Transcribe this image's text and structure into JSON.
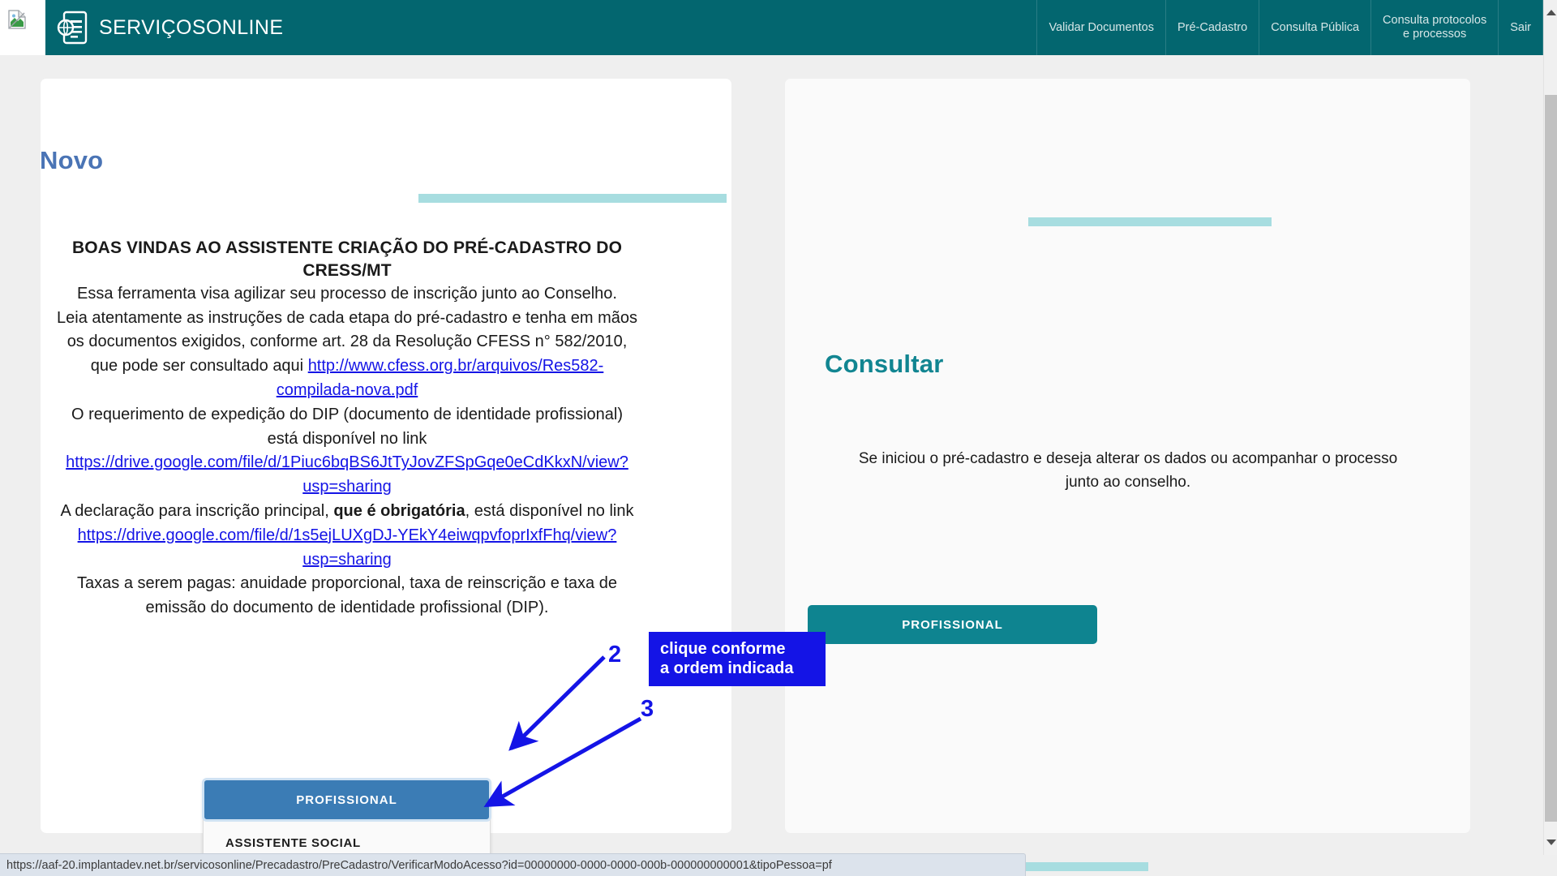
{
  "header": {
    "brand": "SERVIÇOSONLINE",
    "logo_icon": "document-globe-icon",
    "brand_bg": "#03666f",
    "nav": [
      {
        "label": "Validar Documentos"
      },
      {
        "label": "Pré-Cadastro"
      },
      {
        "label": "Consulta Pública"
      },
      {
        "label": "Consulta protocolos\ne processos"
      },
      {
        "label": "Sair"
      }
    ]
  },
  "left_card": {
    "title": "Novo",
    "title_color": "#4a74b5",
    "heading": "BOAS VINDAS AO ASSISTENTE CRIAÇÃO DO PRÉ-CADASTRO DO CRESS/MT",
    "para1": "Essa ferramenta visa agilizar seu processo de inscrição junto ao Conselho.",
    "para2_prefix": "Leia atentamente as instruções de cada etapa do pré-cadastro e tenha em mãos os documentos exigidos, conforme art. 28 da Resolução CFESS n° 582/2010, que pode ser consultado aqui ",
    "link1": "http://www.cfess.org.br/arquivos/Res582-compilada-nova.pdf",
    "para3_prefix": "O requerimento de expedição do DIP (documento de identidade profissional) está disponível no link ",
    "link2": "https://drive.google.com/file/d/1Piuc6bqBS6JtTyJovZFSpGqe0eCdKkxN/view?usp=sharing",
    "para4_a": "A declaração para inscrição principal, ",
    "para4_bold": "que é obrigatória",
    "para4_b": ", está disponível no link ",
    "link3": "https://drive.google.com/file/d/1s5ejLUXgDJ-YEkY4eiwqpvfoprIxfFhq/view?usp=sharing",
    "para5": "Taxas a serem pagas: anuidade proporcional, taxa de reinscrição e taxa de emissão do documento de identidade profissional (DIP).",
    "dropdown_toggle": "PROFISSIONAL",
    "dropdown_item": "ASSISTENTE SOCIAL"
  },
  "right_card": {
    "title": "Consultar",
    "title_color": "#118591",
    "paragraph": "Se iniciou o pré-cadastro e deseja alterar os dados ou acompanhar o processo junto ao conselho.",
    "button": "PROFISSIONAL",
    "button_color": "#0e8490"
  },
  "annotations": {
    "callout": "clique conforme\na ordem indicada",
    "callout_color": "#1414e6",
    "number_2": "2",
    "number_3": "3"
  },
  "status_bar": {
    "url": "https://aaf-20.implantadev.net.br/servicosonline/Precadastro/PreCadastro/VerificarModoAcesso?id=00000000-0000-0000-000b-000000000001&tipoPessoa=pf"
  },
  "theme": {
    "accent_bar": "#a7dde0",
    "page_bg": "#efefef",
    "link": "#1414e6"
  }
}
